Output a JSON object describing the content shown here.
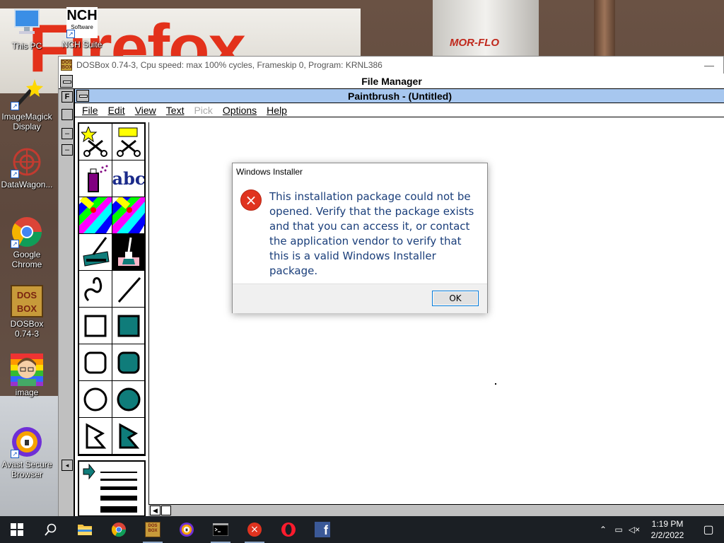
{
  "wallpaper": {
    "logo_text": "Firefox",
    "tank_label": "MOR-FLO"
  },
  "desktop_icons": [
    {
      "label": "This PC"
    },
    {
      "label": "NCH Suite",
      "badge": "NCH",
      "sub": "Software"
    },
    {
      "label": "ImageMagick Display"
    },
    {
      "label": "DataWagon..."
    },
    {
      "label": "Google Chrome"
    },
    {
      "label": "DOSBox 0.74-3",
      "badge": "DOS BOX"
    },
    {
      "label": "image"
    },
    {
      "label": "Avast Secure Browser"
    }
  ],
  "dosbox": {
    "title": "DOSBox 0.74-3, Cpu speed: max 100% cycles, Frameskip  0, Program:  KRNL386",
    "minimize_glyph": "—"
  },
  "file_manager": {
    "title": "File Manager",
    "strip_f": "F"
  },
  "paintbrush": {
    "title": "Paintbrush - (Untitled)",
    "menu": [
      "File",
      "Edit",
      "View",
      "Text",
      "Pick",
      "Options",
      "Help"
    ],
    "abc_label": "abc"
  },
  "dialog": {
    "title": "Windows Installer",
    "message": "This installation package could not be opened.  Verify that the package exists and that you can access it, or contact the application vendor to verify that this is a valid Windows Installer package.",
    "ok_label": "OK",
    "error_icon": "×"
  },
  "taskbar": {
    "time": "1:19 PM",
    "date": "2/2/2022"
  },
  "colors": {
    "paintbrush_title_bg": "#a7c7ef",
    "dialog_text": "#1a3e7a",
    "error_red": "#e0331f",
    "taskbar_bg": "#1b1f24",
    "teal_fill": "#0f7c7a"
  }
}
